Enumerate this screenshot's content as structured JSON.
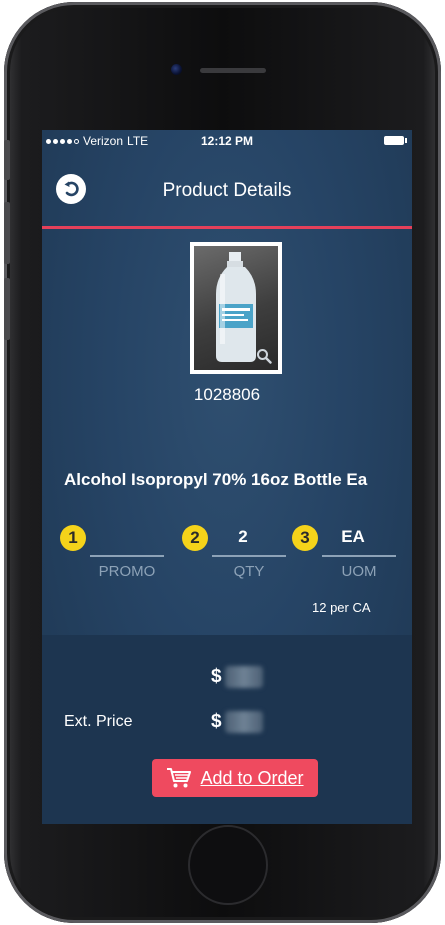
{
  "status_bar": {
    "carrier": "Verizon",
    "network": "LTE",
    "time": "12:12 PM"
  },
  "nav": {
    "title": "Product Details",
    "back_icon": "back-arrow-icon"
  },
  "product": {
    "sku": "1028806",
    "name": "Alcohol Isopropyl 70% 16oz Bottle Ea",
    "image_icon": "zoom-icon"
  },
  "fields": [
    {
      "badge": "1",
      "value": "",
      "label": "PROMO"
    },
    {
      "badge": "2",
      "value": "2",
      "label": "QTY"
    },
    {
      "badge": "3",
      "value": "EA",
      "label": "UOM"
    }
  ],
  "uom_note": "12 per CA",
  "summary": {
    "unit_price_currency": "$",
    "ext_price_label": "Ext. Price",
    "ext_price_currency": "$"
  },
  "actions": {
    "add_to_order_label": "Add to Order",
    "add_to_order_icon": "cart-icon"
  },
  "colors": {
    "accent_red": "#ef4a5f",
    "nav_divider": "#e5405a",
    "badge_yellow": "#f5d31a",
    "screen_bg": "#264465"
  }
}
